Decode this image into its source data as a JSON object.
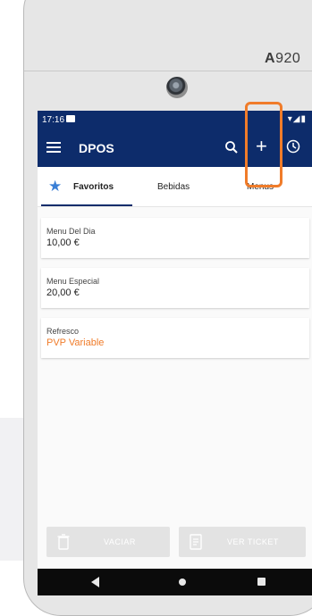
{
  "device": {
    "brand_prefix": "A",
    "brand_model": "920"
  },
  "status_bar": {
    "time": "17:16",
    "signal_icons": "▾◢▮"
  },
  "app_bar": {
    "title": "DPOS"
  },
  "tabs": [
    {
      "label": "Favoritos",
      "active": true
    },
    {
      "label": "Bebidas",
      "active": false
    },
    {
      "label": "Menus",
      "active": false
    }
  ],
  "items": [
    {
      "name": "Menu Del Dia",
      "price": "10,00 €"
    },
    {
      "name": "Menu Especial",
      "price": "20,00 €"
    },
    {
      "name": "Refresco",
      "price": "PVP Variable"
    }
  ],
  "footer": {
    "vaciar_label": "VACIAR",
    "ticket_label": "VER TICKET"
  },
  "colors": {
    "app_bar": "#0d2c6b",
    "accent": "#f07c2a",
    "star": "#3a7fd6"
  },
  "icons": [
    "menu-icon",
    "search-icon",
    "plus-icon",
    "clock-icon",
    "star-icon",
    "trash-icon",
    "receipt-icon",
    "nav-back-icon",
    "nav-home-icon",
    "nav-recent-icon"
  ]
}
